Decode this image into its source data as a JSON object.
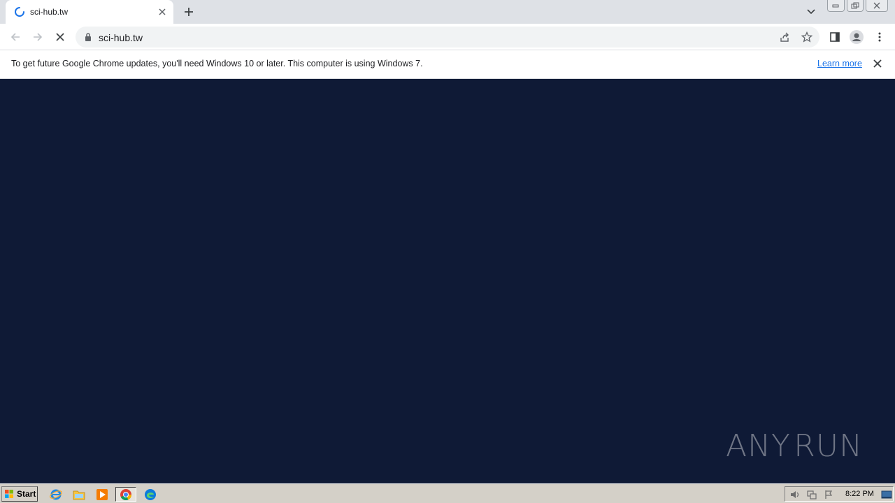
{
  "browser": {
    "tab": {
      "title": "sci-hub.tw",
      "loading": true
    },
    "address_bar": {
      "url": "sci-hub.tw"
    },
    "icons": {
      "back": "arrow-left-icon",
      "forward": "arrow-right-icon",
      "stop": "close-icon",
      "share": "share-icon",
      "bookmark": "star-icon",
      "side_panel": "side-panel-icon",
      "profile": "profile-icon",
      "menu": "kebab-menu-icon"
    }
  },
  "infobar": {
    "message": "To get future Google Chrome updates, you'll need Windows 10 or later. This computer is using Windows 7.",
    "link": "Learn more"
  },
  "page": {
    "background": "#0f1a36"
  },
  "watermark": {
    "left": "ANY",
    "right": "RUN"
  },
  "taskbar": {
    "start_label": "Start",
    "clock": "8:22 PM",
    "apps": [
      "internet-explorer-icon",
      "file-explorer-icon",
      "media-player-icon",
      "chrome-icon",
      "edge-icon"
    ]
  }
}
